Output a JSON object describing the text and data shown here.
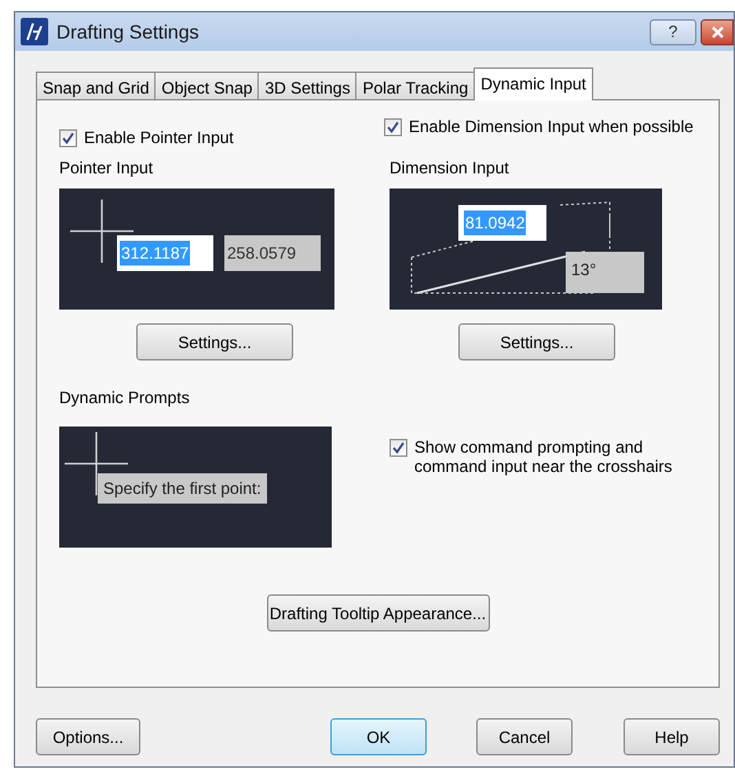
{
  "window": {
    "title": "Drafting Settings",
    "help_glyph": "?"
  },
  "tabs": [
    {
      "label": "Snap and Grid",
      "selected": false
    },
    {
      "label": "Object Snap",
      "selected": false
    },
    {
      "label": "3D Settings",
      "selected": false
    },
    {
      "label": "Polar Tracking",
      "selected": false
    },
    {
      "label": "Dynamic Input",
      "selected": true
    }
  ],
  "pointer_input": {
    "enable": {
      "label": "Enable Pointer Input",
      "checked": true
    },
    "heading": "Pointer Input",
    "preview": {
      "x_value": "312.1187",
      "y_value": "258.0579"
    },
    "button": "Settings..."
  },
  "dimension_input": {
    "enable": {
      "label": "Enable Dimension Input when possible",
      "checked": true
    },
    "heading": "Dimension Input",
    "preview": {
      "length_value": "81.0942",
      "angle_value": "13°"
    },
    "button": "Settings..."
  },
  "dynamic_prompts": {
    "heading": "Dynamic Prompts",
    "preview": {
      "prompt": "Specify the first point:"
    },
    "show": {
      "label": "Show command prompting and command input near the crosshairs",
      "checked": true
    }
  },
  "tooltip_button": "Drafting Tooltip Appearance...",
  "buttons": [
    {
      "label": "Options...",
      "kind": "normal"
    },
    {
      "label": "OK",
      "kind": "default"
    },
    {
      "label": "Cancel",
      "kind": "normal"
    },
    {
      "label": "Help",
      "kind": "normal"
    }
  ]
}
